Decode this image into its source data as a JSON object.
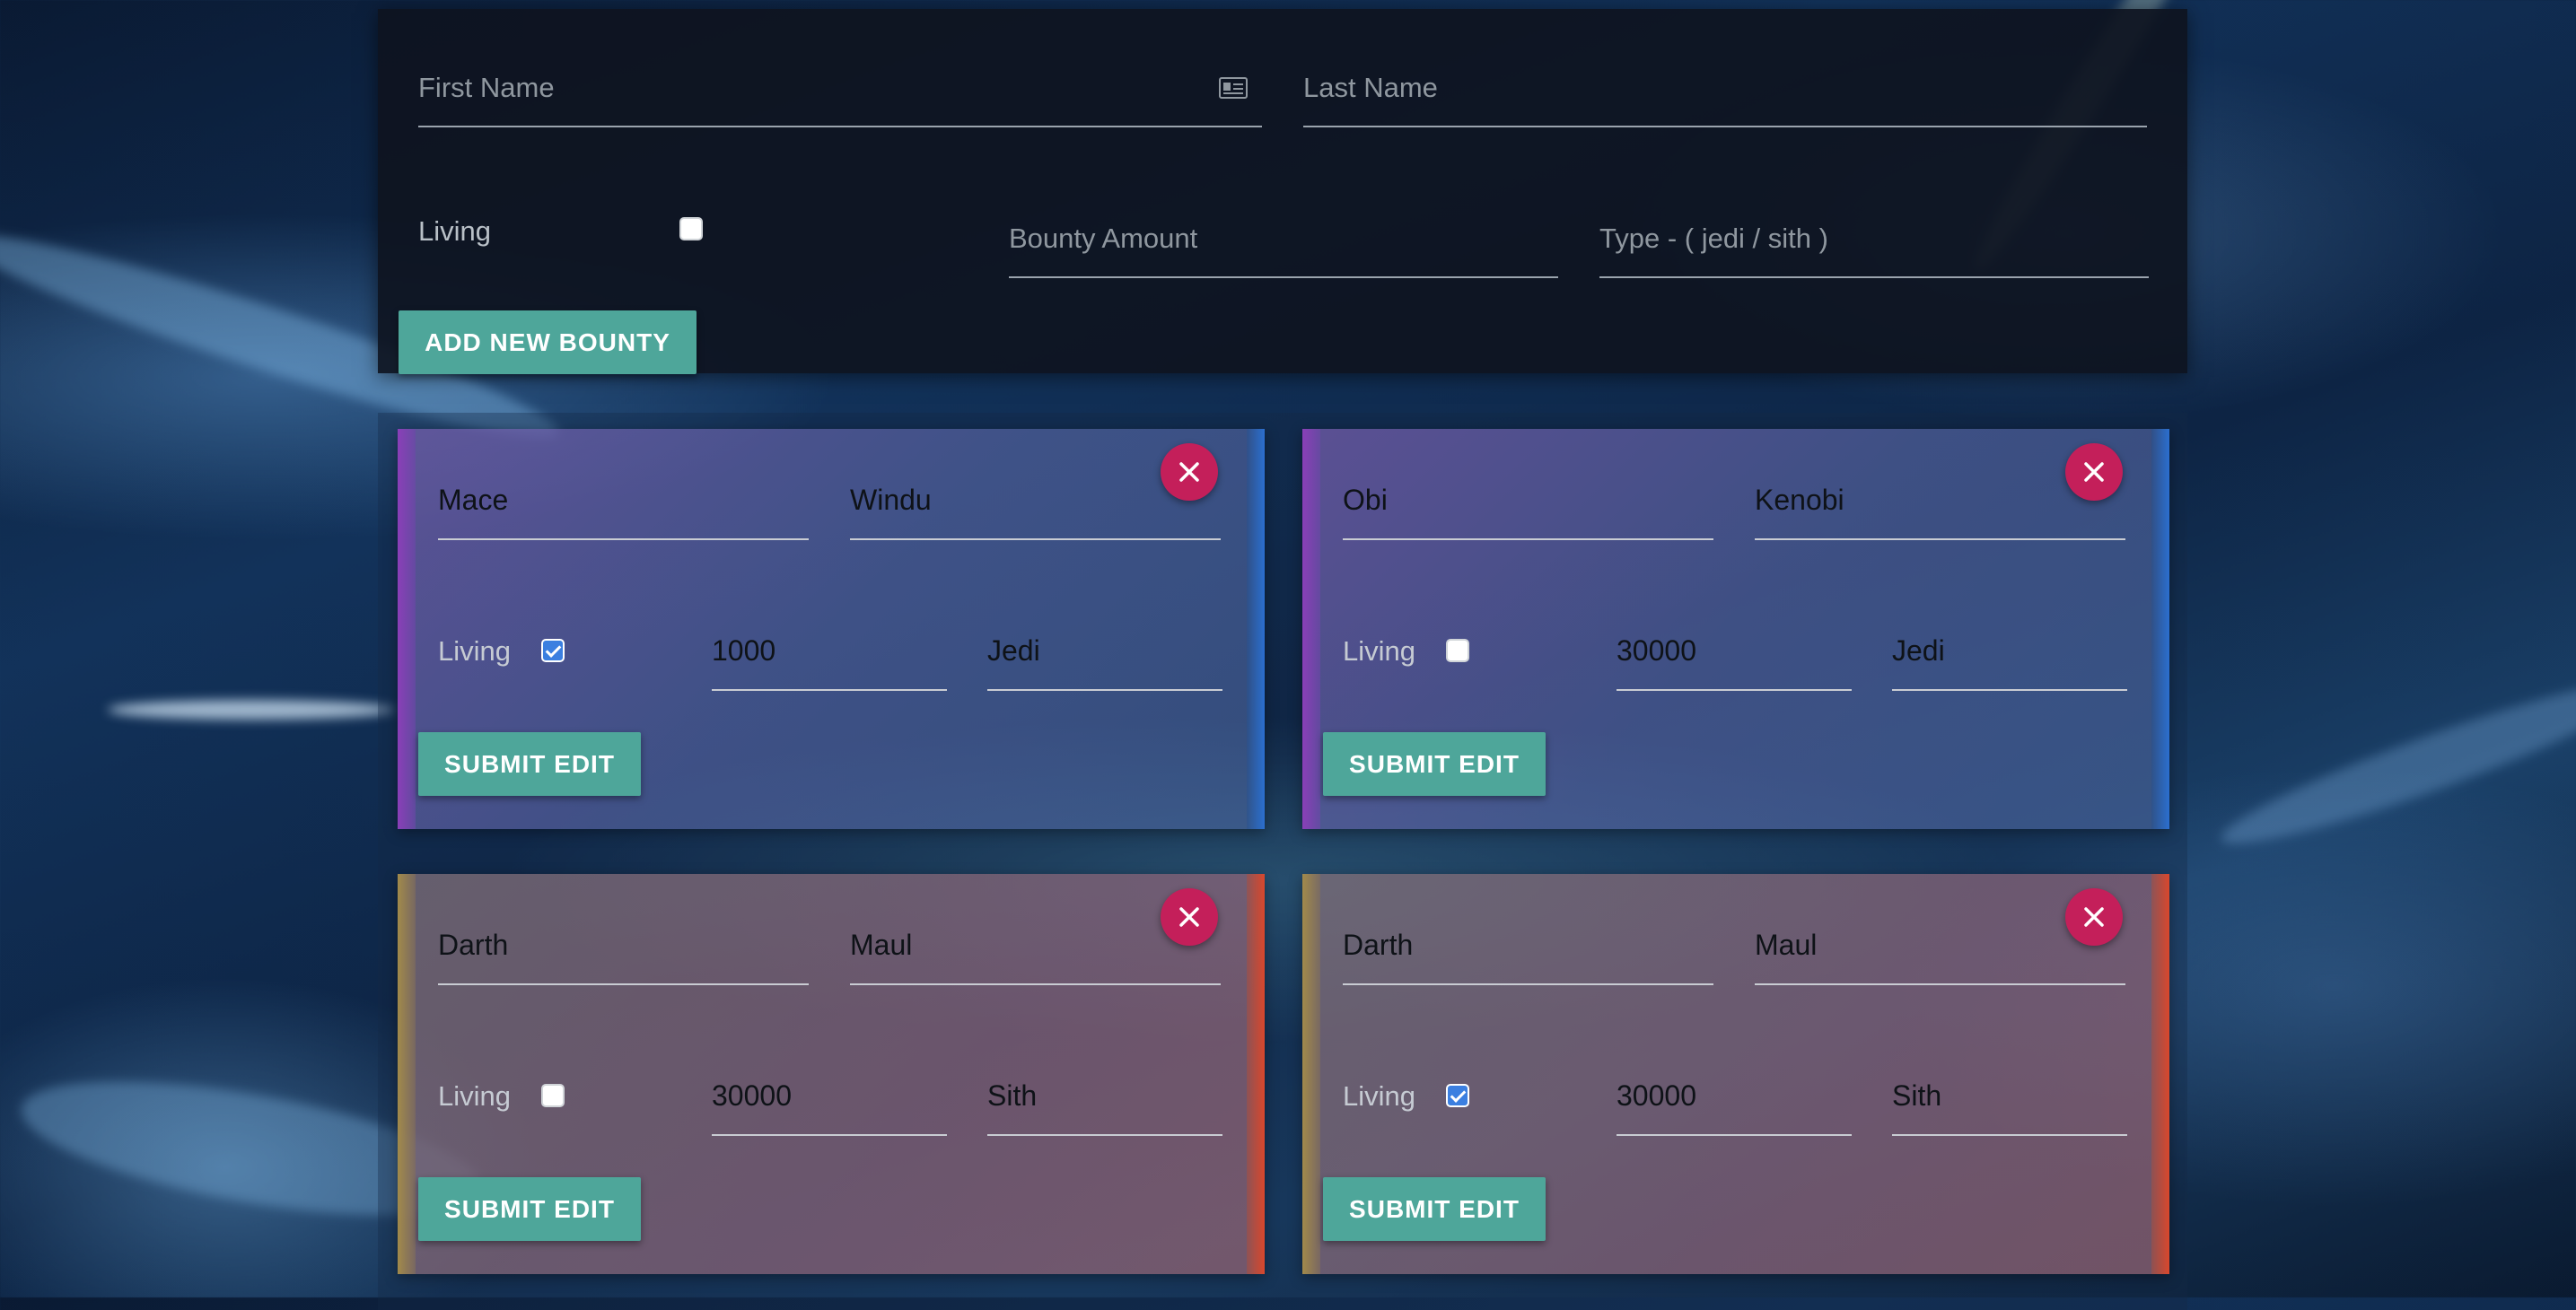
{
  "form": {
    "first_name_placeholder": "First Name",
    "last_name_placeholder": "Last Name",
    "living_label": "Living",
    "living_checked": false,
    "bounty_placeholder": "Bounty Amount",
    "type_placeholder": "Type - ( jedi / sith )",
    "add_button_label": "ADD NEW BOUNTY"
  },
  "bounties": [
    {
      "first_name": "Mace",
      "last_name": "Windu",
      "living_label": "Living",
      "living": true,
      "bounty": "1000",
      "type": "Jedi",
      "submit_label": "SUBMIT EDIT"
    },
    {
      "first_name": "Obi",
      "last_name": "Kenobi",
      "living_label": "Living",
      "living": false,
      "bounty": "30000",
      "type": "Jedi",
      "submit_label": "SUBMIT EDIT"
    },
    {
      "first_name": "Darth",
      "last_name": "Maul",
      "living_label": "Living",
      "living": false,
      "bounty": "30000",
      "type": "Sith",
      "submit_label": "SUBMIT EDIT"
    },
    {
      "first_name": "Darth",
      "last_name": "Maul",
      "living_label": "Living",
      "living": true,
      "bounty": "30000",
      "type": "Sith",
      "submit_label": "SUBMIT EDIT"
    }
  ],
  "colors": {
    "button": "#4ea69a",
    "delete_button": "#c41f5a",
    "jedi_accent": "#8a3fb8",
    "sith_accent": "#d9472c",
    "checkbox_checked": "#3b7fe0"
  },
  "icons": {
    "delete": "close-icon",
    "first_name_field": "id-card-icon"
  }
}
